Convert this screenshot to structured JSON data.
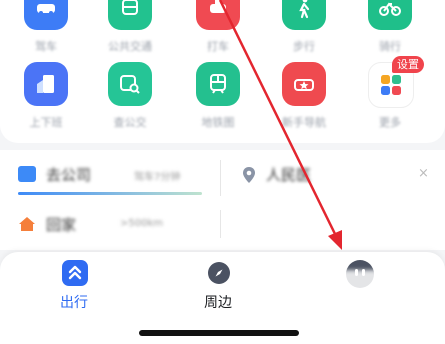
{
  "shortcuts_row1": [
    {
      "label": "驾车",
      "icon": "car-icon",
      "color": "#3d7cf6"
    },
    {
      "label": "公共交通",
      "icon": "bus-icon",
      "color": "#22c28f"
    },
    {
      "label": "打车",
      "icon": "taxi-icon",
      "color": "#f04a52"
    },
    {
      "label": "步行",
      "icon": "walk-icon",
      "color": "#1fbf8a"
    },
    {
      "label": "骑行",
      "icon": "bike-icon",
      "color": "#1fbf8a"
    }
  ],
  "shortcuts_row2": [
    {
      "label": "上下班",
      "icon": "commute-icon",
      "color": "#4b74f6"
    },
    {
      "label": "查公交",
      "icon": "bus-search-icon",
      "color": "#25c596"
    },
    {
      "label": "地铁图",
      "icon": "subway-icon",
      "color": "#24c08f"
    },
    {
      "label": "新手导航",
      "icon": "star-car-icon",
      "color": "#ef4a4f"
    },
    {
      "label": "更多",
      "icon": "more-grid-icon",
      "color": "#ffffff"
    }
  ],
  "settings_badge": "设置",
  "commute": {
    "company_label": "去公司",
    "company_eta": "驾车7分钟",
    "destination_label": "人民医",
    "home_label": "回家",
    "home_distance": ">500km"
  },
  "tabs": [
    {
      "label": "出行",
      "icon": "travel-icon",
      "active": true
    },
    {
      "label": "周边",
      "icon": "compass-icon",
      "active": false
    }
  ],
  "colors": {
    "accent_blue": "#2f6bf2",
    "arrow_red": "#e3262f"
  }
}
